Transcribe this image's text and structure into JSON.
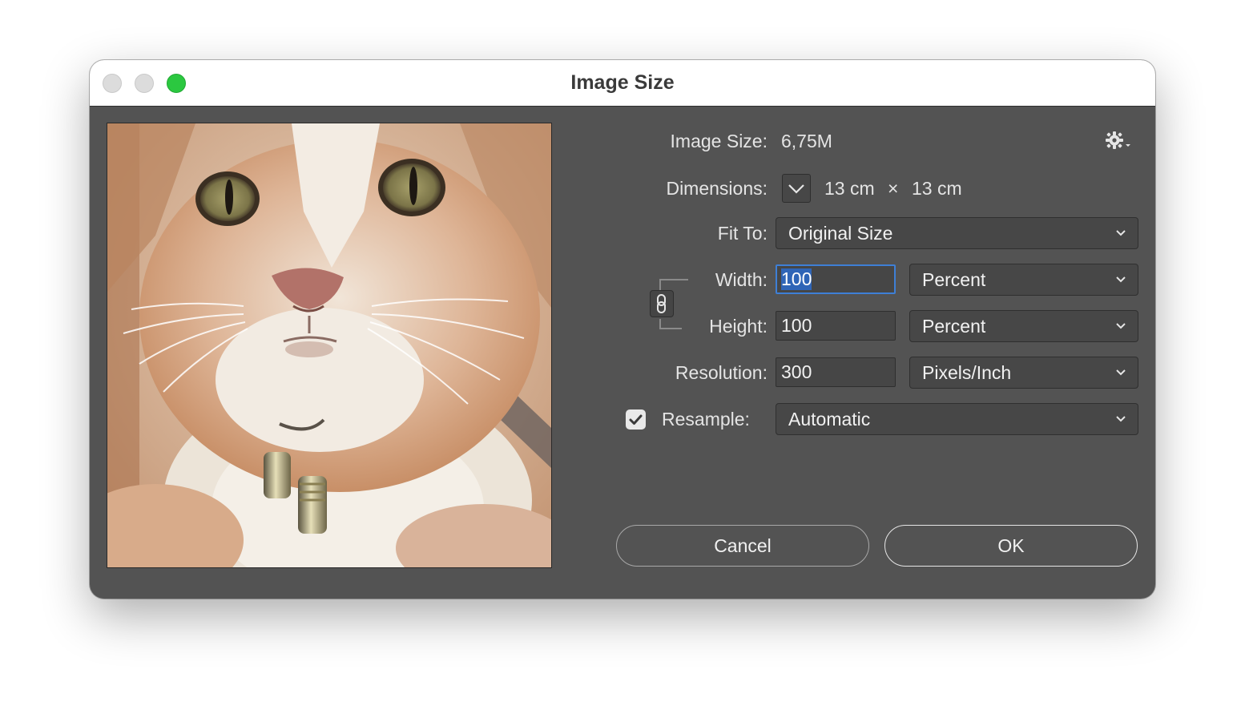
{
  "window": {
    "title": "Image Size"
  },
  "summary": {
    "image_size_label": "Image Size:",
    "image_size_value": "6,75M",
    "dimensions_label": "Dimensions:",
    "dimensions_width": "13 cm",
    "dimensions_separator": "×",
    "dimensions_height": "13 cm"
  },
  "form": {
    "fit_to_label": "Fit To:",
    "fit_to_value": "Original Size",
    "width_label": "Width:",
    "width_value": "100",
    "width_unit": "Percent",
    "height_label": "Height:",
    "height_value": "100",
    "height_unit": "Percent",
    "resolution_label": "Resolution:",
    "resolution_value": "300",
    "resolution_unit": "Pixels/Inch",
    "resample_label": "Resample:",
    "resample_checked": true,
    "resample_value": "Automatic"
  },
  "buttons": {
    "cancel": "Cancel",
    "ok": "OK"
  },
  "icons": {
    "settings": "gear-icon",
    "dimensions_toggle": "chevron-down-icon",
    "constrain": "chain-link-icon",
    "select_chevron": "chevron-down-icon",
    "checkbox": "checkmark-icon"
  },
  "colors": {
    "dialog_background": "#535353",
    "titlebar": "#ffffff",
    "zoom_light": "#2bc840",
    "focus_ring": "#3e7fd6"
  }
}
